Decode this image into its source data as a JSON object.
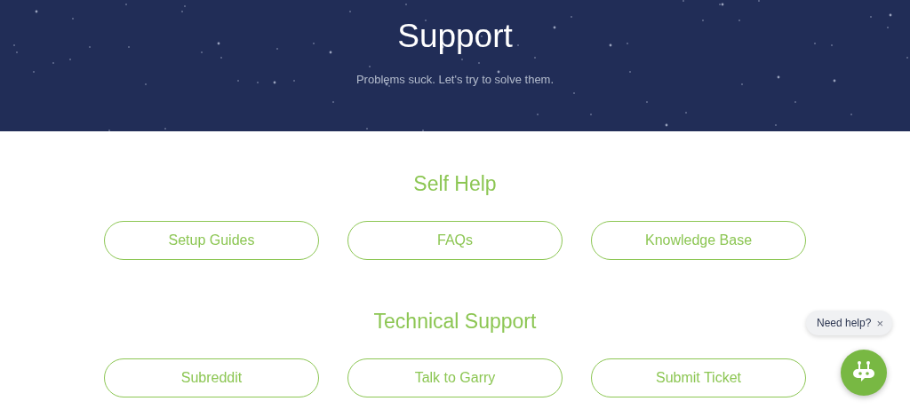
{
  "header": {
    "title": "Support",
    "subtitle": "Problems suck. Let's try to solve them."
  },
  "sections": [
    {
      "title": "Self Help",
      "links": [
        "Setup Guides",
        "FAQs",
        "Knowledge Base"
      ]
    },
    {
      "title": "Technical Support",
      "links": [
        "Subreddit",
        "Talk to Garry",
        "Submit Ticket"
      ]
    }
  ],
  "chat_widget": {
    "bubble": "Need help?",
    "close": "×"
  }
}
